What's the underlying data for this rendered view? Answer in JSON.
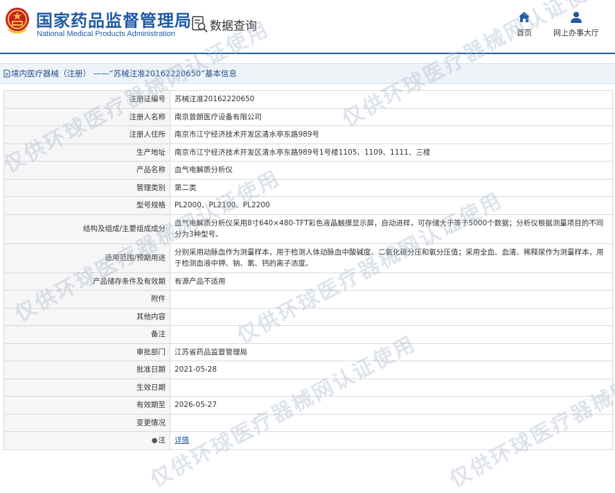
{
  "header": {
    "logo_cn": "国家药品监督管理局",
    "logo_en": "National Medical Products Administration",
    "query_label": "数据查询",
    "nav": [
      {
        "label": "首页",
        "icon": "home-icon"
      },
      {
        "label": "网上办事大厅",
        "icon": "user-icon"
      }
    ]
  },
  "breadcrumb": {
    "section": "境内医疗器械（注册）",
    "separator": "——",
    "current": "“苏械注准20162220650”基本信息"
  },
  "rows": [
    {
      "label": "注册证编号",
      "value": "苏械注准20162220650"
    },
    {
      "label": "注册人名称",
      "value": "南京普朗医疗设备有限公司"
    },
    {
      "label": "注册人住所",
      "value": "南京市江宁经济技术开发区清水亭东路989号"
    },
    {
      "label": "生产地址",
      "value": "南京市江宁经济技术开发区清水亭东路989号1号楼1105、1109、1111、三楼"
    },
    {
      "label": "产品名称",
      "value": "血气电解质分析仪"
    },
    {
      "label": "管理类别",
      "value": "第二类"
    },
    {
      "label": "型号规格",
      "value": "PL2000、PL2100、PL2200"
    },
    {
      "label": "结构及组成/主要组成成分",
      "value": "血气电解质分析仪采用8寸640×480-TFT彩色液晶触摸显示屏，自动进样，可存储大于等于5000个数据；分析仪根据测量项目的不同分为3种型号。"
    },
    {
      "label": "适用范围/预期用途",
      "value": "分别采用动脉血作为测量样本，用于检测人体动脉血中酸碱度、二氧化碳分压和氧分压值；采用全血、血清、稀释尿作为测量样本，用于检测血液中钾、钠、氯、钙的离子浓度。"
    },
    {
      "label": "产品储存条件及有效期",
      "value": "有源产品不适用"
    },
    {
      "label": "附件",
      "value": ""
    },
    {
      "label": "其他内容",
      "value": ""
    },
    {
      "label": "备注",
      "value": ""
    },
    {
      "label": "审批部门",
      "value": "江苏省药品监督管理局"
    },
    {
      "label": "批准日期",
      "value": "2021-05-28"
    },
    {
      "label": "生效日期",
      "value": ""
    },
    {
      "label": "有效期至",
      "value": "2026-05-27"
    },
    {
      "label": "变更情况",
      "value": ""
    },
    {
      "label": "注",
      "value": "详情"
    }
  ],
  "watermark": "仅供环球医疗器械网认证使用",
  "colors": {
    "brand_blue": "#1f5aa6",
    "label_bg": "#f6f6f6",
    "crumb_bg": "#eef3f8"
  }
}
